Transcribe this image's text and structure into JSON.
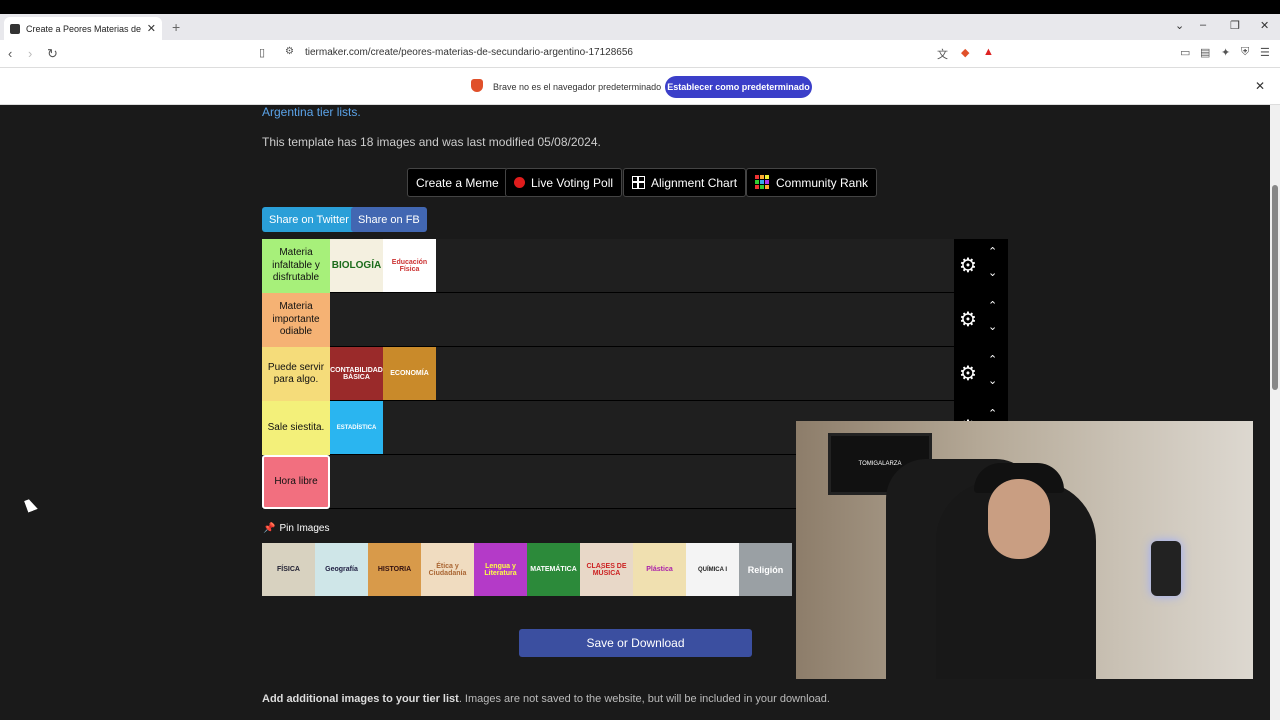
{
  "browser": {
    "tab_title": "Create a Peores Materias de Sec",
    "url": "tiermaker.com/create/peores-materias-de-secundario-argentino-17128656",
    "infobar_text": "Brave no es el navegador predeterminado",
    "infobar_button": "Establecer como predeterminado"
  },
  "page": {
    "link_text": "Argentina tier lists.",
    "template_info": "This template has 18 images and was last modified 05/08/2024.",
    "buttons": {
      "meme": "Create a Meme",
      "poll": "Live Voting Poll",
      "alignment": "Alignment Chart",
      "community": "Community Rank"
    },
    "share_twitter": "Share on Twitter",
    "share_fb": "Share on FB",
    "tiers": [
      {
        "label": "Materia infaltable y disfrutable",
        "color": "#a7f07a",
        "items": [
          "BIOLOGÍA",
          "Educación Física"
        ]
      },
      {
        "label": "Materia importante odiable",
        "color": "#f5b274",
        "items": []
      },
      {
        "label": "Puede servir para algo.",
        "color": "#f5dc7a",
        "items": [
          "CONTABILIDAD BÁSICA",
          "ECONOMÍA"
        ]
      },
      {
        "label": "Sale siestita.",
        "color": "#f3f07a",
        "items": [
          "ESTADÍSTICA"
        ]
      },
      {
        "label": "Hora libre",
        "color": "#f26f7f",
        "items": []
      }
    ],
    "pin_label": "Pin Images",
    "pool": [
      "FÍSICA",
      "Geografía",
      "HISTORIA",
      "Ética y Ciudadanía",
      "Lengua y Literatura",
      "MATEMÁTICA",
      "CLASES DE MÚSICA",
      "Plástica",
      "QUÍMICA I",
      "Religión"
    ],
    "save_button": "Save or Download",
    "bottom_bold": "Add additional images to your tier list",
    "bottom_rest": ". Images are not saved to the website, but will be included in your download."
  },
  "webcam": {
    "monitor_text": "TOMIGALARZA"
  }
}
